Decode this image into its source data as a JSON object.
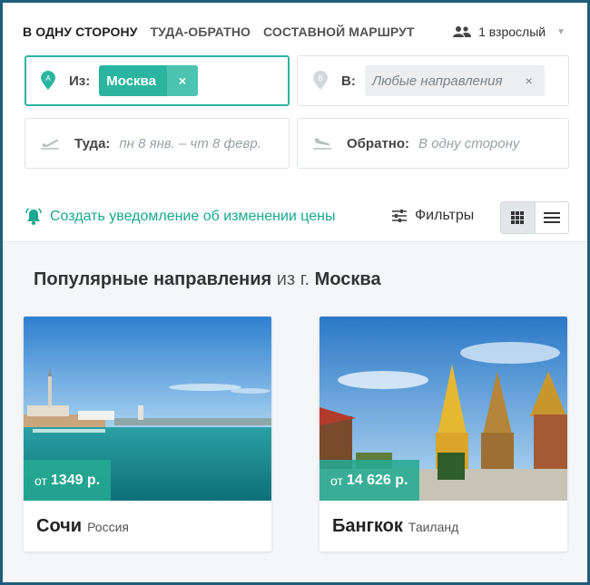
{
  "tabs": [
    {
      "label": "В ОДНУ СТОРОНУ",
      "active": true
    },
    {
      "label": "ТУДА-ОБРАТНО",
      "active": false
    },
    {
      "label": "СОСТАВНОЙ МАРШРУТ",
      "active": false
    }
  ],
  "passengers": {
    "label": "1 взрослый",
    "icon": "users-icon"
  },
  "from": {
    "label": "Из:",
    "marker": "A",
    "value": "Москва",
    "clear_icon": "×"
  },
  "to": {
    "label": "В:",
    "marker": "B",
    "value": "Любые направления",
    "clear_icon": "×"
  },
  "depart": {
    "label": "Туда:",
    "placeholder": "пн 8 янв. – чт 8 февр."
  },
  "return": {
    "label": "Обратно:",
    "placeholder": "В одну сторону"
  },
  "price_alert": {
    "label": "Создать уведомление об изменении цены"
  },
  "filters": {
    "label": "Фильтры"
  },
  "popular": {
    "title": "Популярные направления",
    "from_text": "из г.",
    "city": "Москва"
  },
  "cards": [
    {
      "price_prefix": "от",
      "price": "1349 р.",
      "city": "Сочи",
      "country": "Россия"
    },
    {
      "price_prefix": "от",
      "price": "14 626 р.",
      "city": "Бангкок",
      "country": "Таиланд"
    }
  ],
  "colors": {
    "accent": "#2bb5a0",
    "frame": "#1f5d7a"
  }
}
